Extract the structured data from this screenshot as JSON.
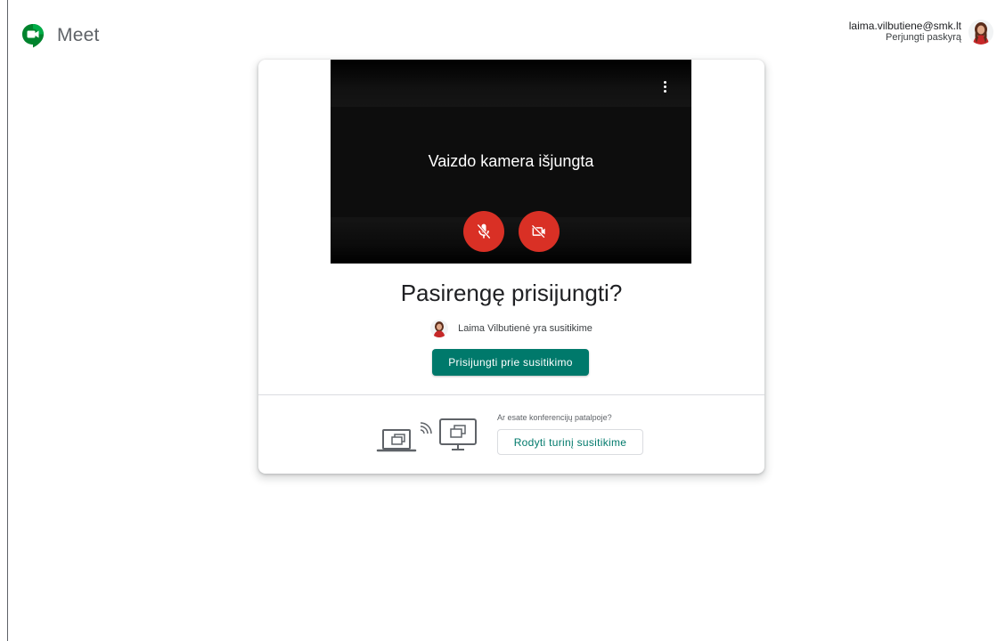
{
  "app": {
    "name": "Meet"
  },
  "account": {
    "email": "laima.vilbutiene@smk.lt",
    "switch_label": "Perjungti paskyrą"
  },
  "preview": {
    "camera_off_text": "Vaizdo kamera išjungta",
    "mic_button_icon": "mic-off-icon",
    "camera_button_icon": "videocam-off-icon",
    "more_icon": "more-vert-icon"
  },
  "join": {
    "title": "Pasirengę prisijungti?",
    "participant_text": "Laima Vilbutienė yra susitikime",
    "join_button": "Prisijungti prie susitikimo"
  },
  "present": {
    "question": "Ar esate konferencijų patalpoje?",
    "button": "Rodyti turinį susitikime"
  },
  "colors": {
    "accent": "#00796b",
    "danger": "#d93025",
    "preview_bg": "#0d0d0d",
    "text": "#202124",
    "muted": "#5f6368"
  }
}
